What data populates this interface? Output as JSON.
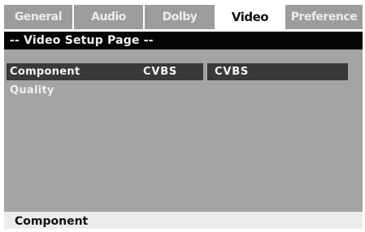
{
  "tabs": [
    {
      "label": "General",
      "active": false
    },
    {
      "label": "Audio",
      "active": false
    },
    {
      "label": "Dolby",
      "active": false
    },
    {
      "label": "Video",
      "active": true
    },
    {
      "label": "Preference",
      "active": false
    }
  ],
  "page": {
    "header": "-- Video Setup Page --"
  },
  "menu": {
    "items": [
      {
        "label": "Component",
        "value": "CVBS",
        "selected": true
      },
      {
        "label": "Quality",
        "value": ""
      }
    ],
    "options": [
      {
        "label": "CVBS",
        "selected": true
      }
    ]
  },
  "status": {
    "text": "Component"
  },
  "colors": {
    "tab_inactive": "#9c9c9c",
    "tab_active": "#ffffff",
    "header_bg": "#050505",
    "content_bg": "#a4a4a4",
    "highlight": "#3a3a3a",
    "status_bg": "#ececec"
  }
}
